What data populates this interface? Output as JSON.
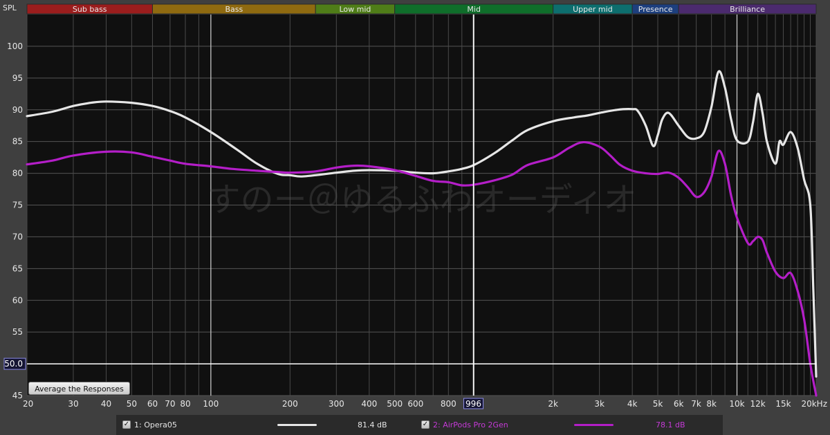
{
  "band_bar": {
    "y_label": "SPL",
    "bands": [
      {
        "name": "Sub bass",
        "from": 20,
        "to": 60,
        "color": "#9b1d1d"
      },
      {
        "name": "Bass",
        "from": 60,
        "to": 250,
        "color": "#8f6a10"
      },
      {
        "name": "Low mid",
        "from": 250,
        "to": 500,
        "color": "#4f7d18"
      },
      {
        "name": "Mid",
        "from": 500,
        "to": 2000,
        "color": "#0f6e2a"
      },
      {
        "name": "Upper mid",
        "from": 2000,
        "to": 4000,
        "color": "#0d6e6e"
      },
      {
        "name": "Presence",
        "from": 4000,
        "to": 6000,
        "color": "#1d3f7e"
      },
      {
        "name": "Brilliance",
        "from": 6000,
        "to": 20000,
        "color": "#4b2a6e"
      }
    ]
  },
  "watermark": "すのー＠ゆるふわオーディオ",
  "cursor": {
    "freq": 996,
    "freq_label": "996",
    "spl": 50,
    "spl_label": "50.0"
  },
  "average_button_label": "Average the Responses",
  "legend": [
    {
      "checkbox": "✓",
      "label": "1: Opera05",
      "value": "81.4 dB",
      "color": "#e6e6e6"
    },
    {
      "checkbox": "✓",
      "label": "2: AirPods Pro 2Gen",
      "value": "78.1 dB",
      "color": "#b41ec8"
    }
  ],
  "chart_data": {
    "type": "line",
    "xscale": "log",
    "xlim": [
      20,
      20000
    ],
    "ylim": [
      45,
      105
    ],
    "grid": true,
    "y_ticks": [
      45,
      50,
      55,
      60,
      65,
      70,
      75,
      80,
      85,
      90,
      95,
      100
    ],
    "x_ticks": [
      {
        "v": 20,
        "label": "20"
      },
      {
        "v": 30,
        "label": "30"
      },
      {
        "v": 40,
        "label": "40"
      },
      {
        "v": 50,
        "label": "50"
      },
      {
        "v": 60,
        "label": "60"
      },
      {
        "v": 70,
        "label": "70"
      },
      {
        "v": 80,
        "label": "80"
      },
      {
        "v": 100,
        "label": "100"
      },
      {
        "v": 200,
        "label": "200"
      },
      {
        "v": 300,
        "label": "300"
      },
      {
        "v": 400,
        "label": "400"
      },
      {
        "v": 500,
        "label": "500"
      },
      {
        "v": 600,
        "label": "600"
      },
      {
        "v": 800,
        "label": "800"
      },
      {
        "v": 2000,
        "label": "2k"
      },
      {
        "v": 3000,
        "label": "3k"
      },
      {
        "v": 4000,
        "label": "4k"
      },
      {
        "v": 5000,
        "label": "5k"
      },
      {
        "v": 6000,
        "label": "6k"
      },
      {
        "v": 7000,
        "label": "7k"
      },
      {
        "v": 8000,
        "label": "8k"
      },
      {
        "v": 10000,
        "label": "10k"
      },
      {
        "v": 12000,
        "label": "12k"
      },
      {
        "v": 15000,
        "label": "15k"
      },
      {
        "v": 20000,
        "label": "20kHz"
      }
    ],
    "series": [
      {
        "name": "1: Opera05",
        "color": "#e6e6e6",
        "points": [
          [
            20,
            89
          ],
          [
            25,
            89.7
          ],
          [
            30,
            90.6
          ],
          [
            35,
            91.1
          ],
          [
            40,
            91.3
          ],
          [
            50,
            91.1
          ],
          [
            60,
            90.6
          ],
          [
            70,
            89.8
          ],
          [
            80,
            88.8
          ],
          [
            100,
            86.5
          ],
          [
            125,
            83.8
          ],
          [
            150,
            81.5
          ],
          [
            180,
            79.9
          ],
          [
            200,
            79.7
          ],
          [
            220,
            79.5
          ],
          [
            250,
            79.7
          ],
          [
            300,
            80.1
          ],
          [
            350,
            80.4
          ],
          [
            400,
            80.5
          ],
          [
            500,
            80.4
          ],
          [
            600,
            80.1
          ],
          [
            700,
            80.0
          ],
          [
            800,
            80.3
          ],
          [
            900,
            80.7
          ],
          [
            1000,
            81.3
          ],
          [
            1200,
            83.2
          ],
          [
            1400,
            85.2
          ],
          [
            1600,
            86.8
          ],
          [
            2000,
            88.2
          ],
          [
            2400,
            88.8
          ],
          [
            2700,
            89.1
          ],
          [
            3000,
            89.5
          ],
          [
            3500,
            90.0
          ],
          [
            4000,
            90.1
          ],
          [
            4200,
            89.8
          ],
          [
            4500,
            87.5
          ],
          [
            4800,
            84.3
          ],
          [
            5000,
            86.0
          ],
          [
            5200,
            88.5
          ],
          [
            5500,
            89.5
          ],
          [
            6000,
            87.5
          ],
          [
            6500,
            85.7
          ],
          [
            7000,
            85.5
          ],
          [
            7500,
            86.5
          ],
          [
            8000,
            90.5
          ],
          [
            8500,
            96.0
          ],
          [
            9000,
            93.5
          ],
          [
            9500,
            88.5
          ],
          [
            10000,
            85.2
          ],
          [
            11000,
            85.0
          ],
          [
            11500,
            88.0
          ],
          [
            12000,
            92.5
          ],
          [
            12500,
            89.5
          ],
          [
            13000,
            85.0
          ],
          [
            14000,
            81.5
          ],
          [
            14500,
            85.0
          ],
          [
            15000,
            84.5
          ],
          [
            16000,
            86.5
          ],
          [
            17000,
            84.0
          ],
          [
            18000,
            79.0
          ],
          [
            19000,
            75.0
          ],
          [
            19500,
            62.0
          ],
          [
            20000,
            48.0
          ]
        ]
      },
      {
        "name": "2: AirPods Pro 2Gen",
        "color": "#b41ec8",
        "points": [
          [
            20,
            81.4
          ],
          [
            25,
            82.0
          ],
          [
            30,
            82.8
          ],
          [
            40,
            83.4
          ],
          [
            50,
            83.3
          ],
          [
            60,
            82.6
          ],
          [
            70,
            82.0
          ],
          [
            80,
            81.5
          ],
          [
            100,
            81.1
          ],
          [
            120,
            80.7
          ],
          [
            150,
            80.4
          ],
          [
            180,
            80.2
          ],
          [
            200,
            80.1
          ],
          [
            250,
            80.3
          ],
          [
            300,
            80.9
          ],
          [
            350,
            81.2
          ],
          [
            400,
            81.1
          ],
          [
            500,
            80.5
          ],
          [
            600,
            79.6
          ],
          [
            700,
            78.8
          ],
          [
            800,
            78.6
          ],
          [
            900,
            78.1
          ],
          [
            1000,
            78.2
          ],
          [
            1200,
            78.9
          ],
          [
            1400,
            79.8
          ],
          [
            1600,
            81.3
          ],
          [
            2000,
            82.5
          ],
          [
            2300,
            84.0
          ],
          [
            2600,
            84.9
          ],
          [
            3000,
            84.2
          ],
          [
            3300,
            82.8
          ],
          [
            3600,
            81.3
          ],
          [
            4000,
            80.4
          ],
          [
            4500,
            80.0
          ],
          [
            5000,
            79.9
          ],
          [
            5500,
            80.1
          ],
          [
            6000,
            79.3
          ],
          [
            6500,
            77.8
          ],
          [
            7000,
            76.3
          ],
          [
            7500,
            77.0
          ],
          [
            8000,
            79.5
          ],
          [
            8500,
            83.5
          ],
          [
            9000,
            81.5
          ],
          [
            9500,
            76.5
          ],
          [
            10000,
            73.0
          ],
          [
            11000,
            69.0
          ],
          [
            11500,
            69.3
          ],
          [
            12000,
            70.0
          ],
          [
            12500,
            69.5
          ],
          [
            13000,
            67.5
          ],
          [
            14000,
            64.5
          ],
          [
            15000,
            63.5
          ],
          [
            16000,
            64.3
          ],
          [
            17000,
            61.5
          ],
          [
            18000,
            57.0
          ],
          [
            19000,
            50.0
          ],
          [
            20000,
            45.0
          ]
        ]
      }
    ]
  }
}
